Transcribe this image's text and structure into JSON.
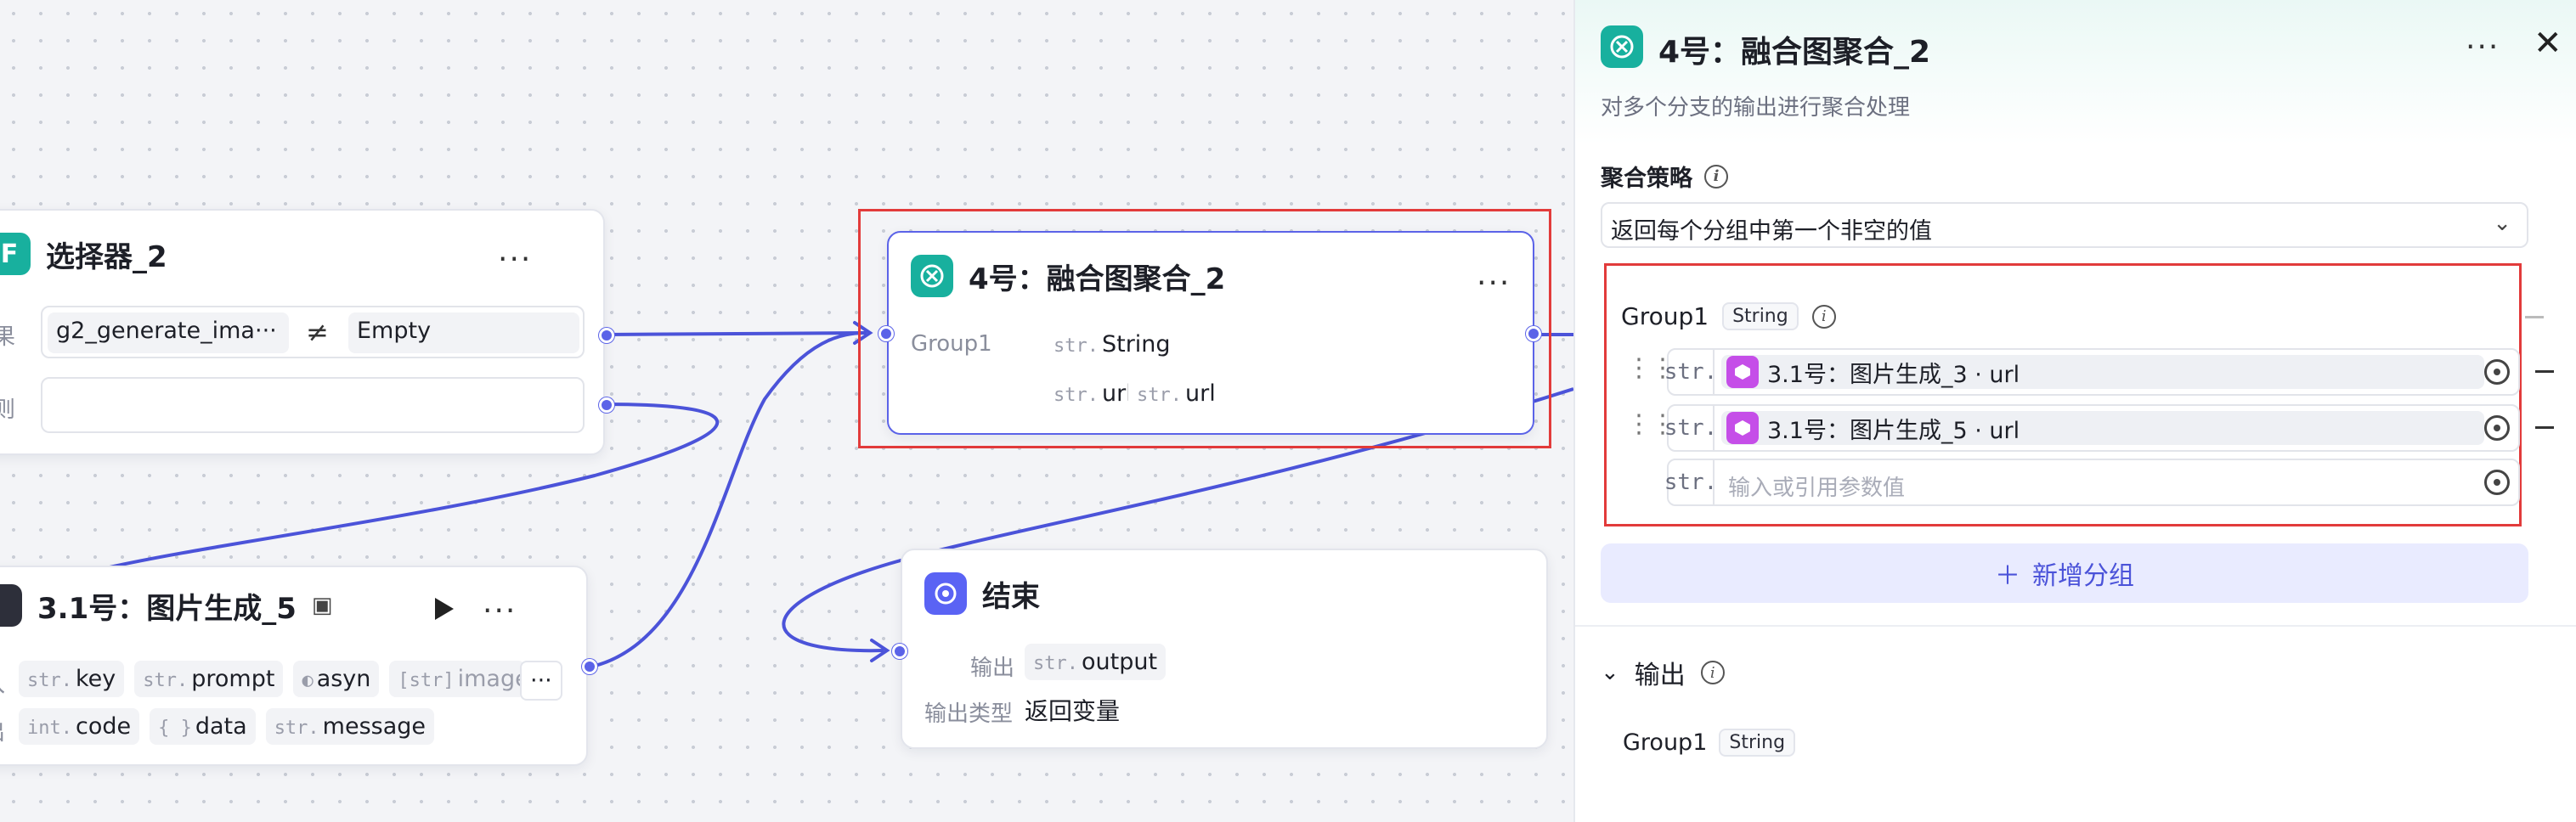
{
  "canvas": {
    "selector": {
      "icon": "F",
      "title": "选择器_2",
      "row1_label": "结果",
      "condition_left": "g2_generate_ima···",
      "operator": "≠",
      "condition_right": "Empty",
      "row2_label": "否则"
    },
    "aggregate_node": {
      "title": "4号：融合图聚合_2",
      "group_label": "Group1",
      "type_chip": {
        "t": "str.",
        "v": "String"
      },
      "refs": [
        {
          "t": "str.",
          "v": "url"
        },
        {
          "t": "str.",
          "v": "url"
        }
      ]
    },
    "image_node": {
      "title": "3.1号：图片生成_5",
      "inputs_label": "入",
      "outputs_label": "出",
      "inputs": [
        {
          "t": "str.",
          "v": "key"
        },
        {
          "t": "str.",
          "v": "prompt"
        },
        {
          "t": "◐",
          "v": "asyn"
        },
        {
          "t": "[str]",
          "v": "image_url"
        }
      ],
      "overflow": "···",
      "outputs": [
        {
          "t": "int.",
          "v": "code"
        },
        {
          "t": "{ }",
          "v": "data"
        },
        {
          "t": "str.",
          "v": "message"
        }
      ]
    },
    "end_node": {
      "title": "结束",
      "output_label": "输出",
      "output_chip": {
        "t": "str.",
        "v": "output"
      },
      "type_label": "输出类型",
      "type_value": "返回变量"
    }
  },
  "panel": {
    "title": "4号：融合图聚合_2",
    "subtitle": "对多个分支的输出进行聚合处理",
    "strategy_label": "聚合策略",
    "strategy_value": "返回每个分组中第一个非空的值",
    "group": {
      "name": "Group1",
      "type": "String",
      "rows": [
        {
          "type": "str.",
          "ref": "3.1号：图片生成_3 · url"
        },
        {
          "type": "str.",
          "ref": "3.1号：图片生成_5 · url"
        }
      ],
      "input_type": "str.",
      "input_placeholder": "输入或引用参数值"
    },
    "add_group_label": "新增分组",
    "output_section_label": "输出",
    "output_item": {
      "name": "Group1",
      "type": "String"
    }
  },
  "colors": {
    "accent": "#5b63e8",
    "teal": "#18b09e",
    "highlight": "#e23b3b",
    "ref_icon": "#c54ee8"
  }
}
